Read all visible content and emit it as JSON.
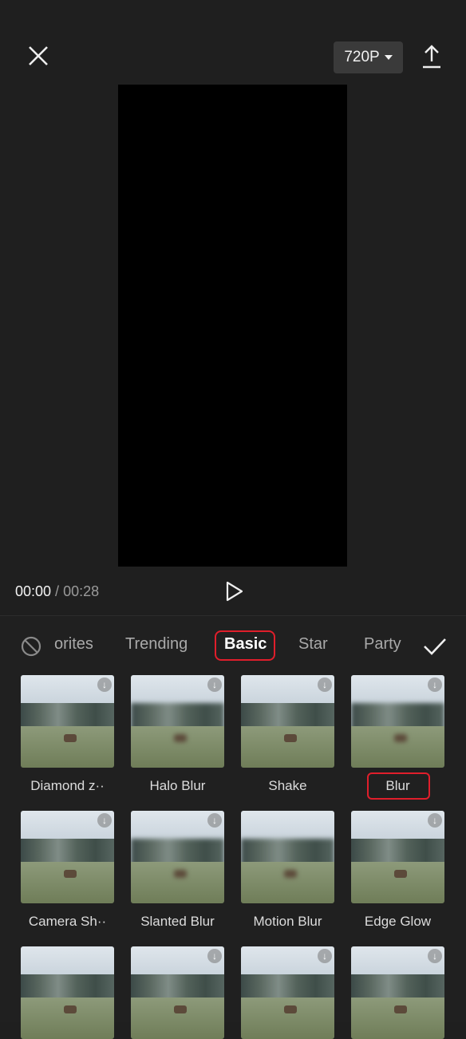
{
  "header": {
    "resolution": "720P",
    "icons": {
      "close": "close-icon",
      "export": "export-upload-icon",
      "caret": "caret-down-icon"
    }
  },
  "player": {
    "current_time": "00:00",
    "separator": " / ",
    "total_time": "00:28",
    "play_icon": "play-icon"
  },
  "effects": {
    "none_icon": "no-effect-icon",
    "confirm_icon": "checkmark-icon",
    "tabs": [
      {
        "label": "orites"
      },
      {
        "label": "Trending"
      },
      {
        "label": "Basic",
        "active": true
      },
      {
        "label": "Star"
      },
      {
        "label": "Party"
      }
    ],
    "items": [
      {
        "name": "Diamond z··"
      },
      {
        "name": "Halo Blur"
      },
      {
        "name": "Shake"
      },
      {
        "name": "Blur"
      },
      {
        "name": "Camera Sh··"
      },
      {
        "name": "Slanted Blur"
      },
      {
        "name": "Motion Blur"
      },
      {
        "name": "Edge Glow"
      },
      {
        "name": ""
      },
      {
        "name": ""
      },
      {
        "name": ""
      },
      {
        "name": ""
      }
    ],
    "highlight_color": "#e01e2b"
  }
}
